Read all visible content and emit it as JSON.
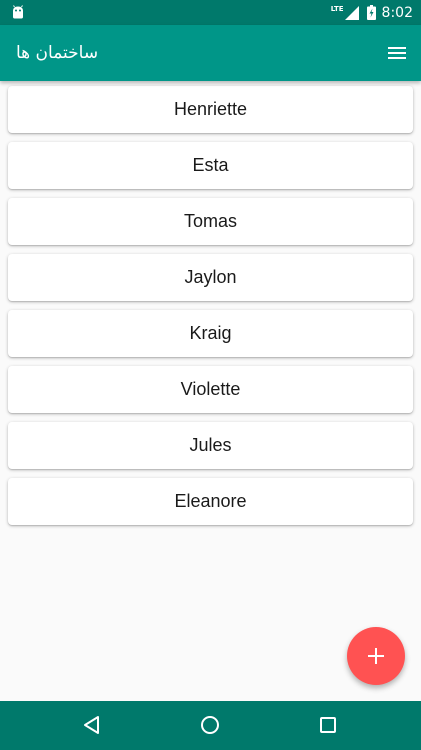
{
  "status_bar": {
    "network_label": "LTE",
    "time": "8:02",
    "icons": [
      "android-icon",
      "signal-icon",
      "battery-icon"
    ]
  },
  "toolbar": {
    "title": "ساختمان ها",
    "menu_icon": "menu-icon"
  },
  "list": {
    "items": [
      {
        "label": "Henriette"
      },
      {
        "label": "Esta"
      },
      {
        "label": "Tomas"
      },
      {
        "label": "Jaylon"
      },
      {
        "label": "Kraig"
      },
      {
        "label": "Violette"
      },
      {
        "label": "Jules"
      },
      {
        "label": "Eleanore"
      }
    ]
  },
  "fab": {
    "icon": "plus-icon"
  },
  "nav_bar": {
    "icons": [
      "back-icon",
      "home-icon",
      "recents-icon"
    ]
  },
  "colors": {
    "status_bar": "#00796b",
    "toolbar": "#009688",
    "background": "#fafafa",
    "card": "#ffffff",
    "fab": "#ff5252",
    "nav_bar": "#00796b"
  }
}
